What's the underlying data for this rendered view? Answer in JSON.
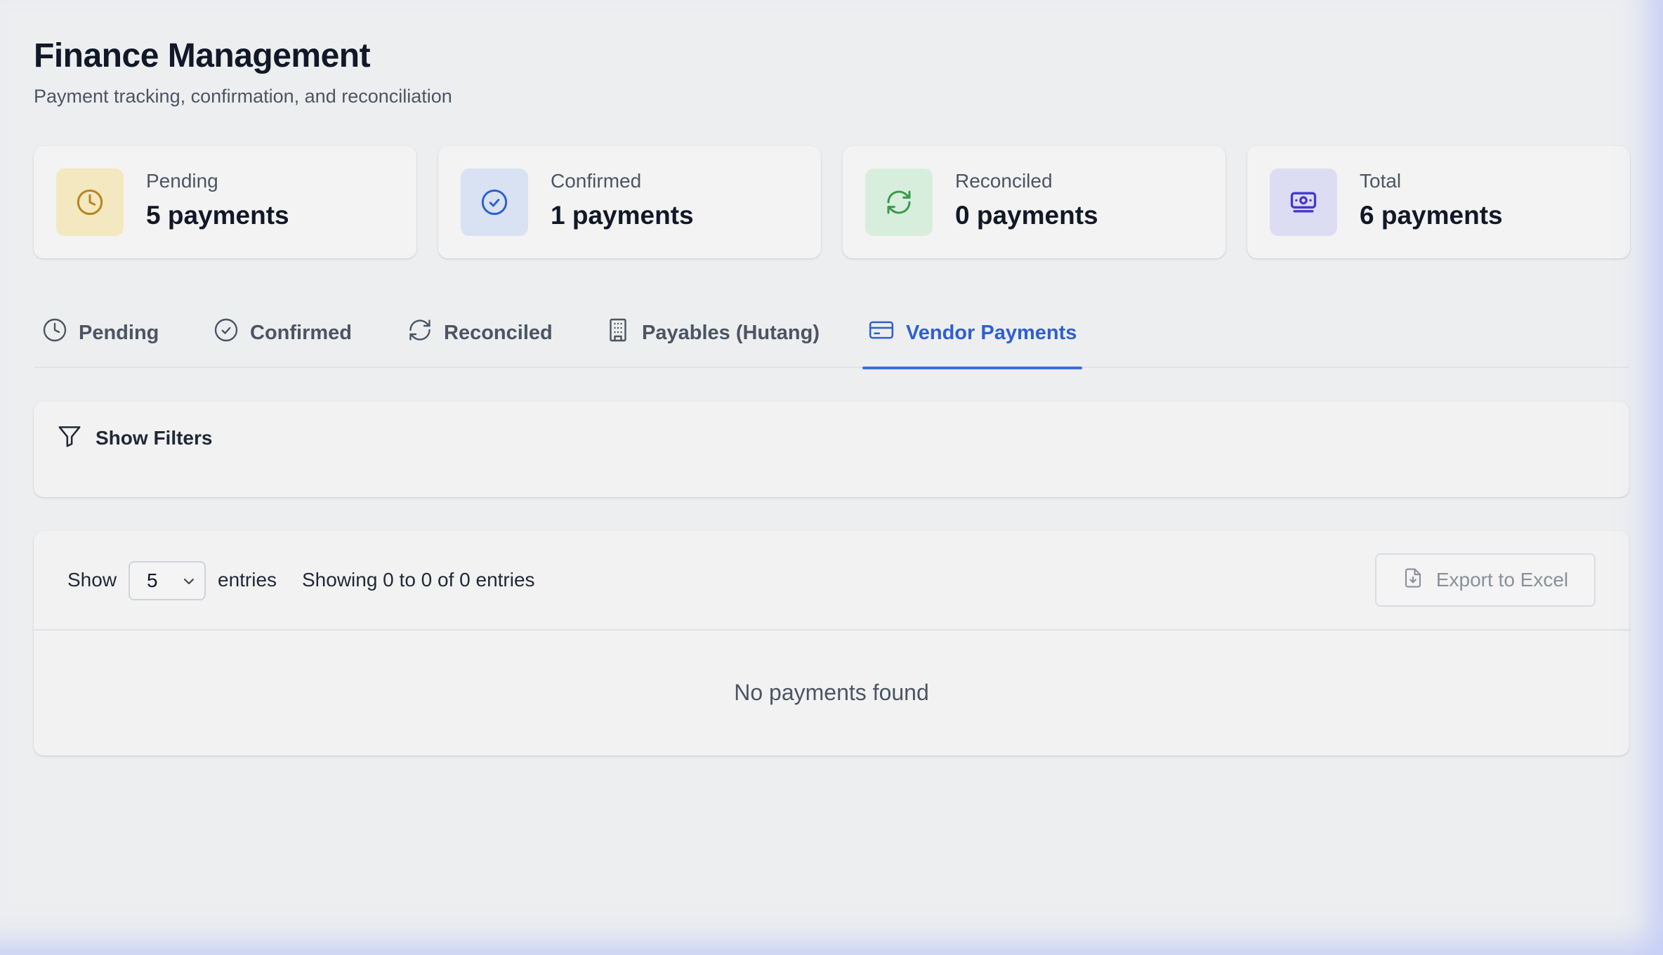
{
  "header": {
    "title": "Finance Management",
    "subtitle": "Payment tracking, confirmation, and reconciliation"
  },
  "stats": [
    {
      "label": "Pending",
      "value": "5 payments",
      "icon": "clock-icon",
      "color": "#b7841f",
      "bg": "#f3e8bf"
    },
    {
      "label": "Confirmed",
      "value": "1 payments",
      "icon": "check-circle-icon",
      "color": "#2f5fd0",
      "bg": "#d9e2f3"
    },
    {
      "label": "Reconciled",
      "value": "0 payments",
      "icon": "refresh-icon",
      "color": "#3a9a4a",
      "bg": "#d8eedd"
    },
    {
      "label": "Total",
      "value": "6 payments",
      "icon": "banknote-icon",
      "color": "#4338ca",
      "bg": "#dcdcf2"
    }
  ],
  "tabs": [
    {
      "label": "Pending",
      "icon": "clock-icon",
      "active": false
    },
    {
      "label": "Confirmed",
      "icon": "check-circle-icon",
      "active": false
    },
    {
      "label": "Reconciled",
      "icon": "refresh-icon",
      "active": false
    },
    {
      "label": "Payables (Hutang)",
      "icon": "building-icon",
      "active": false
    },
    {
      "label": "Vendor Payments",
      "icon": "credit-card-icon",
      "active": true
    }
  ],
  "filters": {
    "toggle_label": "Show Filters",
    "icon": "filter-icon"
  },
  "table": {
    "show_label": "Show",
    "page_size": "5",
    "entries_label": "entries",
    "showing_text": "Showing 0 to 0 of 0 entries",
    "export_label": "Export to Excel",
    "export_icon": "file-download-icon",
    "empty_message": "No payments found"
  },
  "colors": {
    "accent": "#2f5fd0",
    "background": "#edeef0"
  }
}
